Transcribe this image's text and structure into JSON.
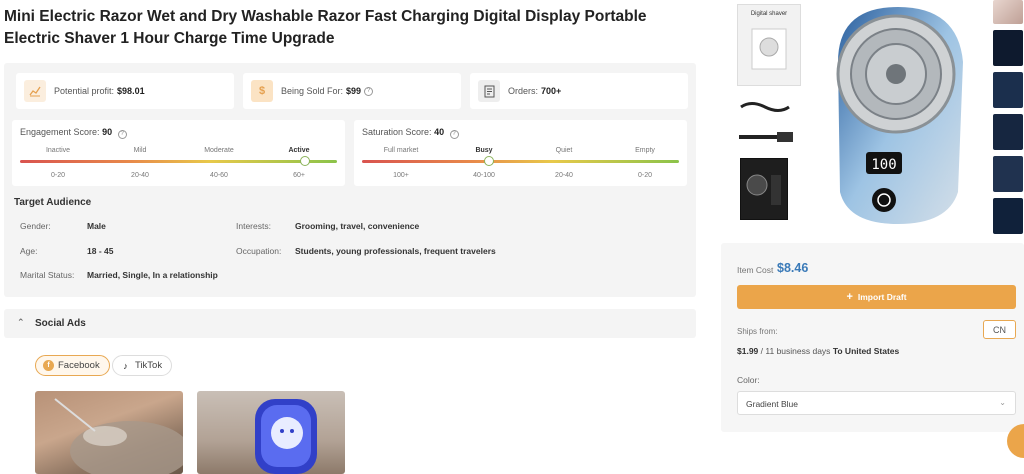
{
  "product": {
    "title": "Mini Electric Razor Wet and Dry Washable Razor Fast Charging Digital Display Portable Electric Shaver 1 Hour Charge Time Upgrade"
  },
  "stats": {
    "profit_label": "Potential profit:",
    "profit_value": "$98.01",
    "sold_label": "Being Sold For:",
    "sold_value": "$99",
    "orders_label": "Orders:",
    "orders_value": "700+"
  },
  "engagement": {
    "label": "Engagement Score:",
    "value": "90",
    "level": 0.9,
    "levels": [
      "Inactive",
      "Mild",
      "Moderate",
      "Active"
    ],
    "ranges": [
      "0-20",
      "20-40",
      "40-60",
      "60+"
    ]
  },
  "saturation": {
    "label": "Saturation Score:",
    "value": "40",
    "level": 0.4,
    "levels": [
      "Full market",
      "Busy",
      "Quiet",
      "Empty"
    ],
    "ranges": [
      "100+",
      "40-100",
      "20-40",
      "0-20"
    ]
  },
  "audience": {
    "title": "Target Audience",
    "gender_label": "Gender:",
    "gender_value": "Male",
    "age_label": "Age:",
    "age_value": "18 - 45",
    "marital_label": "Marital Status:",
    "marital_value": "Married, Single, In a relationship",
    "interests_label": "Interests:",
    "interests_value": "Grooming, travel, convenience",
    "occupation_label": "Occupation:",
    "occupation_value": "Students, young professionals, frequent travelers"
  },
  "social": {
    "title": "Social Ads",
    "facebook": "Facebook",
    "tiktok": "TikTok"
  },
  "gallery": {
    "box_caption": "Digital shaver",
    "display_readout": "100"
  },
  "purchase": {
    "cost_label": "Item Cost",
    "cost_value": "$8.46",
    "import_label": "Import Draft",
    "ships_label": "Ships from:",
    "origin": "CN",
    "ship_price": "$1.99",
    "ship_days": "/ 11 business days",
    "ship_dest": "To United States",
    "color_label": "Color:",
    "color_value": "Gradient Blue"
  },
  "colors": {
    "accent": "#eba54a",
    "price": "#3a7ab8",
    "panel": "#f4f4f4"
  }
}
